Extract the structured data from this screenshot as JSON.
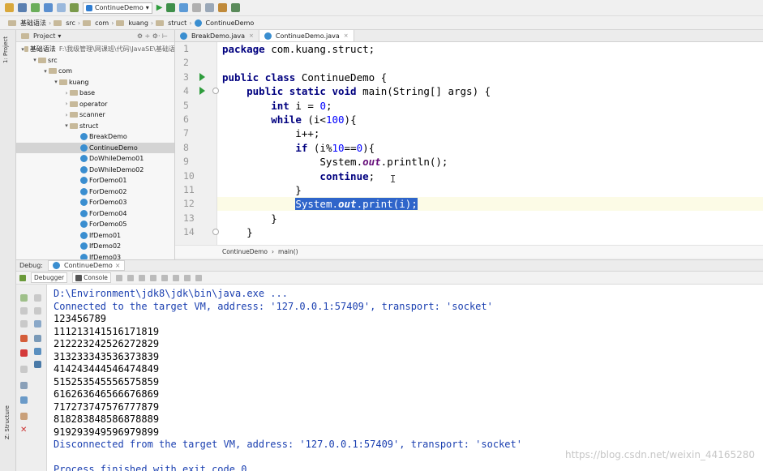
{
  "toolbar": {
    "run_config": "ContinueDemo",
    "icons": [
      "folder-open-icon",
      "save-icon",
      "sync-icon",
      "back-icon",
      "forward-icon",
      "build-icon",
      "run-icon",
      "debug-icon",
      "coverage-icon",
      "stop-icon",
      "structure-icon",
      "sdk-icon",
      "vcs-icon"
    ]
  },
  "breadcrumb": {
    "items": [
      "基础语法",
      "src",
      "com",
      "kuang",
      "struct",
      "ContinueDemo"
    ]
  },
  "left_strip": {
    "label": "1: Project"
  },
  "project": {
    "header": "Project",
    "tree": [
      {
        "label": "基础语法",
        "hint": "F:\\我级管理\\网课班\\代码\\JavaSE\\基础语",
        "depth": 0,
        "arrow": "▾",
        "kind": "module"
      },
      {
        "label": "src",
        "depth": 1,
        "arrow": "▾",
        "kind": "folder"
      },
      {
        "label": "com",
        "depth": 2,
        "arrow": "▾",
        "kind": "folder"
      },
      {
        "label": "kuang",
        "depth": 3,
        "arrow": "▾",
        "kind": "folder"
      },
      {
        "label": "base",
        "depth": 4,
        "arrow": "›",
        "kind": "folder"
      },
      {
        "label": "operator",
        "depth": 4,
        "arrow": "›",
        "kind": "folder"
      },
      {
        "label": "scanner",
        "depth": 4,
        "arrow": "›",
        "kind": "folder"
      },
      {
        "label": "struct",
        "depth": 4,
        "arrow": "▾",
        "kind": "folder"
      },
      {
        "label": "BreakDemo",
        "depth": 5,
        "arrow": "",
        "kind": "class"
      },
      {
        "label": "ContinueDemo",
        "depth": 5,
        "arrow": "",
        "kind": "class",
        "selected": true
      },
      {
        "label": "DoWhileDemo01",
        "depth": 5,
        "arrow": "",
        "kind": "class"
      },
      {
        "label": "DoWhileDemo02",
        "depth": 5,
        "arrow": "",
        "kind": "class"
      },
      {
        "label": "ForDemo01",
        "depth": 5,
        "arrow": "",
        "kind": "class"
      },
      {
        "label": "ForDemo02",
        "depth": 5,
        "arrow": "",
        "kind": "class"
      },
      {
        "label": "ForDemo03",
        "depth": 5,
        "arrow": "",
        "kind": "class"
      },
      {
        "label": "ForDemo04",
        "depth": 5,
        "arrow": "",
        "kind": "class"
      },
      {
        "label": "ForDemo05",
        "depth": 5,
        "arrow": "",
        "kind": "class"
      },
      {
        "label": "IfDemo01",
        "depth": 5,
        "arrow": "",
        "kind": "class"
      },
      {
        "label": "IfDemo02",
        "depth": 5,
        "arrow": "",
        "kind": "class"
      },
      {
        "label": "IfDemo03",
        "depth": 5,
        "arrow": "",
        "kind": "class"
      }
    ]
  },
  "editor": {
    "tabs": [
      {
        "label": "BreakDemo.java",
        "active": false
      },
      {
        "label": "ContinueDemo.java",
        "active": true
      }
    ],
    "lines": [
      {
        "n": "1",
        "t": "package com.kuang.struct;"
      },
      {
        "n": "2",
        "t": ""
      },
      {
        "n": "3",
        "t": "public class ContinueDemo {"
      },
      {
        "n": "4",
        "t": "    public static void main(String[] args) {"
      },
      {
        "n": "5",
        "t": "        int i = 0;"
      },
      {
        "n": "6",
        "t": "        while (i<100){"
      },
      {
        "n": "7",
        "t": "            i++;"
      },
      {
        "n": "8",
        "t": "            if (i%10==0){"
      },
      {
        "n": "9",
        "t": "                System.out.println();"
      },
      {
        "n": "10",
        "t": "                continue;"
      },
      {
        "n": "11",
        "t": "            }"
      },
      {
        "n": "12",
        "t": "            System.out.print(i);"
      },
      {
        "n": "13",
        "t": "        }"
      },
      {
        "n": "14",
        "t": "    }"
      }
    ],
    "crumb": [
      "ContinueDemo",
      "main()"
    ]
  },
  "debug": {
    "label": "Debug:",
    "tab": "ContinueDemo",
    "tools": [
      "Debugger",
      "Console"
    ]
  },
  "console": {
    "lines": [
      {
        "t": "D:\\Environment\\jdk8\\jdk\\bin\\java.exe ...",
        "sys": true
      },
      {
        "t": "Connected to the target VM, address: '127.0.0.1:57409', transport: 'socket'",
        "sys": true
      },
      {
        "t": "123456789",
        "sys": false
      },
      {
        "t": "111213141516171819",
        "sys": false
      },
      {
        "t": "212223242526272829",
        "sys": false
      },
      {
        "t": "313233343536373839",
        "sys": false
      },
      {
        "t": "414243444546474849",
        "sys": false
      },
      {
        "t": "515253545556575859",
        "sys": false
      },
      {
        "t": "616263646566676869",
        "sys": false
      },
      {
        "t": "717273747576777879",
        "sys": false
      },
      {
        "t": "818283848586878889",
        "sys": false
      },
      {
        "t": "919293949596979899",
        "sys": false
      },
      {
        "t": "Disconnected from the target VM, address: '127.0.0.1:57409', transport: 'socket'",
        "sys": true
      },
      {
        "t": "",
        "sys": false
      },
      {
        "t": "Process finished with exit code 0",
        "sys": true
      }
    ],
    "watermark": "https://blog.csdn.net/weixin_44165280"
  },
  "bottom_strip": {
    "label": "Z: Structure"
  },
  "colors": {
    "accent": "#2f65ca",
    "keyword": "#00007f",
    "number": "#0000ff",
    "system_text": "#1a3fb0"
  }
}
